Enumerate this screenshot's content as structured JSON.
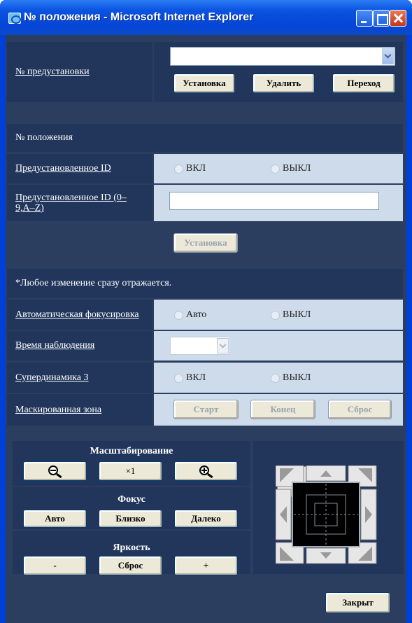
{
  "window": {
    "title": "№ положения - Microsoft Internet Explorer"
  },
  "preset": {
    "label": "№ предустановки",
    "select_value": "",
    "set_label": "Установка",
    "delete_label": "Удалить",
    "goto_label": "Переход"
  },
  "position_header": "№ положения",
  "preset_id_display": {
    "label": "Предустановленное ID",
    "on": "ВКЛ",
    "off": "ВЫКЛ"
  },
  "preset_id_text": {
    "label": "Предустановленное ID (0–9,A–Z)",
    "value": ""
  },
  "set_button_label": "Установка",
  "note": "*Любое изменение сразу отражается.",
  "auto_focus": {
    "label": "Автоматическая фокусировка",
    "auto": "Авто",
    "off": "ВЫКЛ"
  },
  "dwell_time": {
    "label": "Время наблюдения",
    "value": ""
  },
  "super_dynamic": {
    "label": "Супердинамика 3",
    "on": "ВКЛ",
    "off": "ВЫКЛ"
  },
  "privacy_zone": {
    "label": "Маскированная зона",
    "start": "Старт",
    "end": "Конец",
    "reset": "Сброс"
  },
  "zoom": {
    "title": "Масштабирование",
    "reset": "×1",
    "out_icon": "zoom-out-icon",
    "in_icon": "zoom-in-icon"
  },
  "focus": {
    "title": "Фокус",
    "auto": "Авто",
    "near": "Близко",
    "far": "Далеко"
  },
  "brightness": {
    "title": "Яркость",
    "minus": "-",
    "reset": "Сброс",
    "plus": "+"
  },
  "close_label": "Закрыт",
  "colors": {
    "titlebar": "#0a53e0",
    "panel": "#22365c",
    "background": "#2c3e60",
    "value_cell": "#cddbeb"
  }
}
